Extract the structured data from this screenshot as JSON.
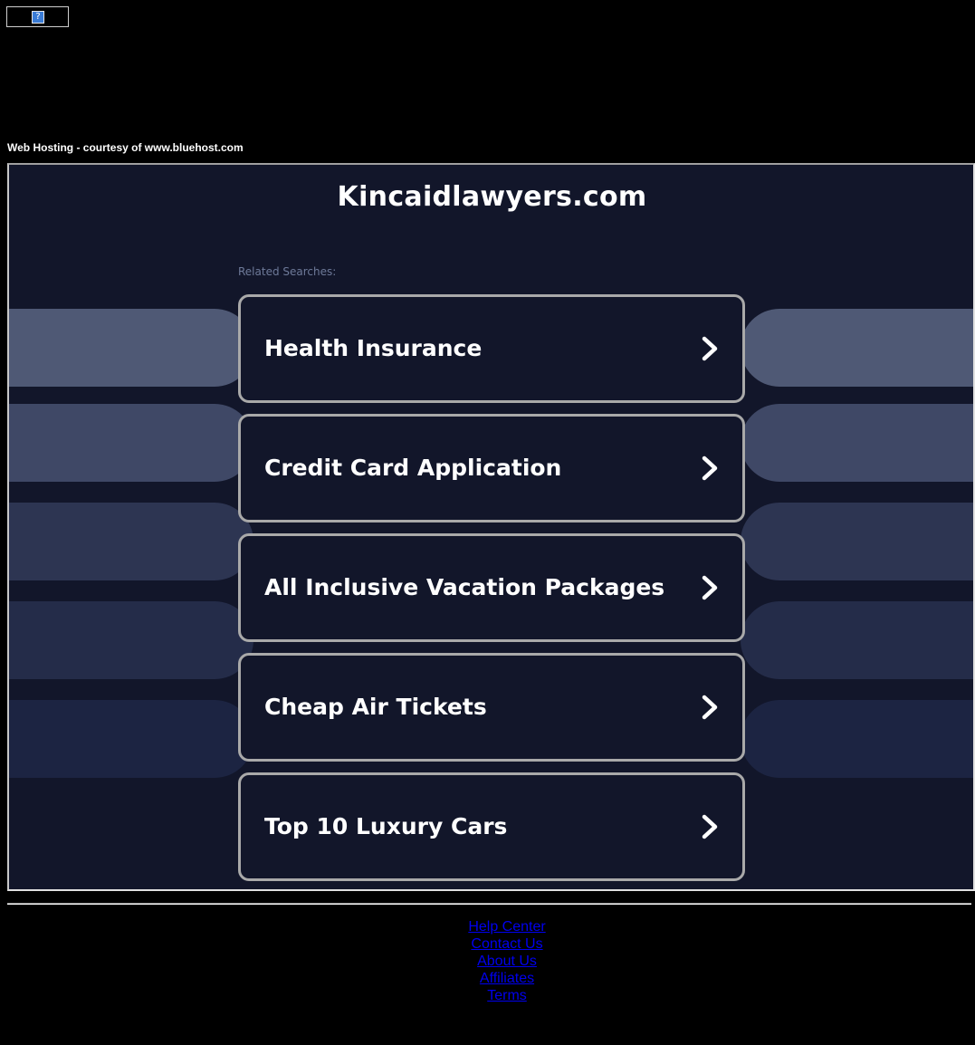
{
  "ad_placeholder": {
    "icon_text": "?",
    "icon_name": "broken-image-icon"
  },
  "hosting_note": "Web Hosting - courtesy of www.bluehost.com",
  "site_title": "Kincaidlawyers.com",
  "related_label": "Related Searches:",
  "searches": [
    {
      "label": "Health Insurance"
    },
    {
      "label": "Credit Card Application"
    },
    {
      "label": "All Inclusive Vacation Packages"
    },
    {
      "label": "Cheap Air Tickets"
    },
    {
      "label": "Top 10 Luxury Cars"
    }
  ],
  "footer_links": [
    {
      "label": "Help Center"
    },
    {
      "label": "Contact Us"
    },
    {
      "label": "About Us"
    },
    {
      "label": "Affiliates"
    },
    {
      "label": "Terms"
    }
  ],
  "colors": {
    "page_background": "#000000",
    "frame_background": "#12162a",
    "card_border": "#a9a9a9",
    "link": "#0000ee",
    "pill_shades": [
      "#4f5975",
      "#3f4866",
      "#2d3552",
      "#242c49",
      "#1c2442"
    ]
  }
}
